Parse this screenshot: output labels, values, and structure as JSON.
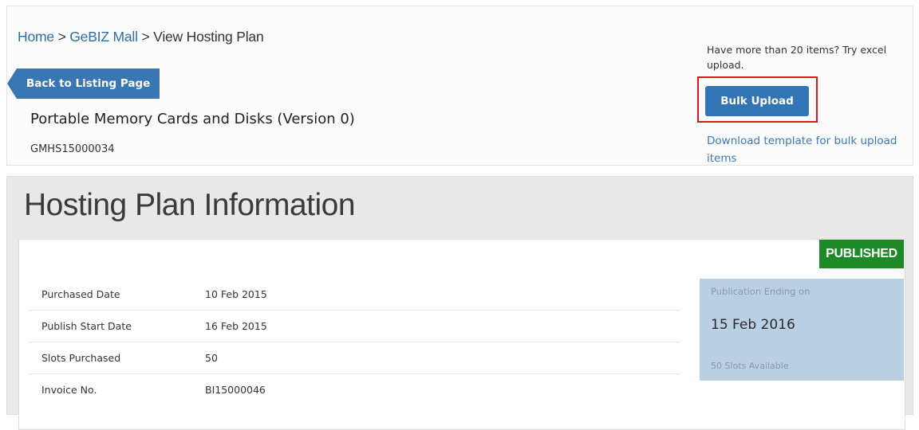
{
  "breadcrumb": {
    "items": [
      {
        "label": "Home"
      },
      {
        "label": "GeBIZ Mall"
      },
      {
        "label": "View Hosting Plan"
      }
    ],
    "separator": ">"
  },
  "header": {
    "back_label": "Back to Listing Page",
    "plan_title": "Portable Memory Cards and Disks (Version 0)",
    "plan_code": "GMHS15000034"
  },
  "bulk_upload": {
    "hint": "Have more than 20 items? Try excel upload.",
    "button_label": "Bulk Upload",
    "template_link": "Download template for bulk upload items",
    "highlight_color": "#e0141b"
  },
  "hosting_plan": {
    "heading": "Hosting Plan Information",
    "status": "PUBLISHED",
    "status_color": "#1d8a26",
    "details": [
      {
        "label": "Purchased Date",
        "value": "10 Feb 2015"
      },
      {
        "label": "Publish Start Date",
        "value": "16 Feb 2015"
      },
      {
        "label": "Slots Purchased",
        "value": "50"
      },
      {
        "label": "Invoice No.",
        "value": "BI15000046"
      }
    ],
    "publication": {
      "label": "Publication Ending on",
      "date": "15 Feb 2016",
      "slots": "50 Slots Available"
    }
  }
}
